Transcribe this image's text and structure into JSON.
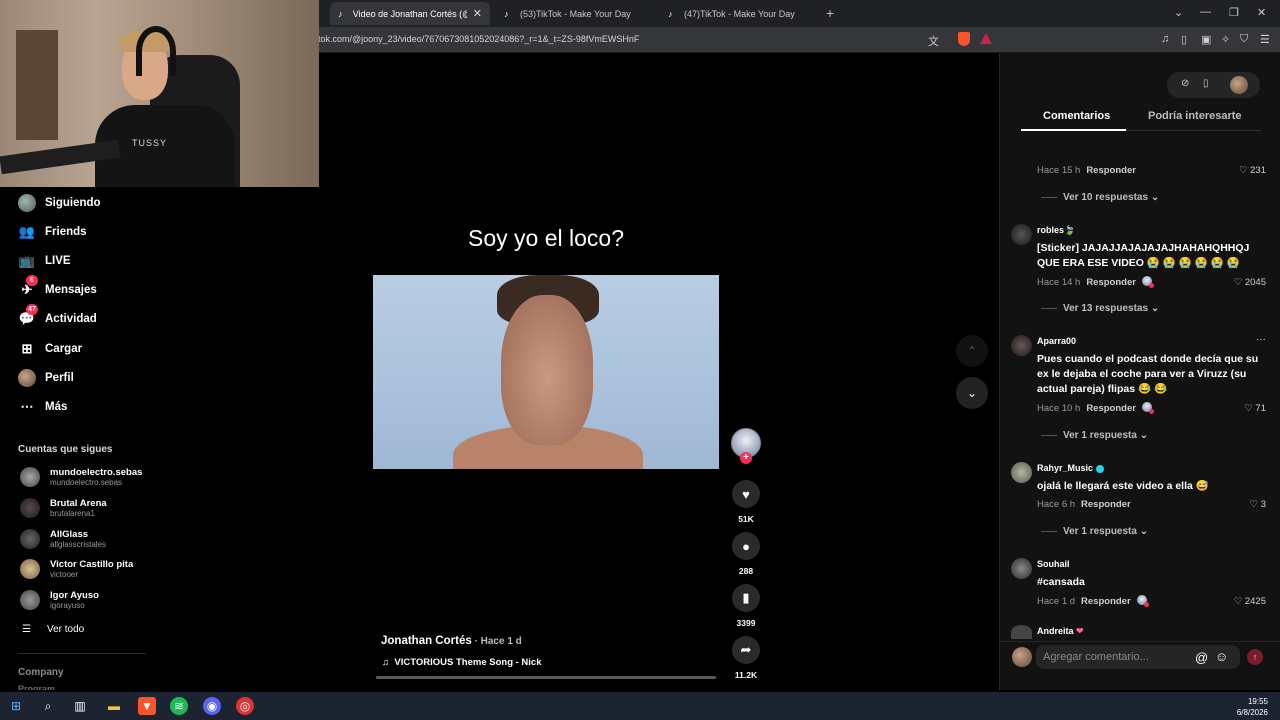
{
  "browser": {
    "tabs": [
      {
        "title": "Video de Jonathan Cortés (@joo",
        "active": true
      },
      {
        "title": "(53)TikTok - Make Your Day",
        "active": false
      },
      {
        "title": "(47)TikTok - Make Your Day",
        "active": false
      }
    ],
    "url": "tok.com/@joony_23/video/7670673081052024086?_r=1&_t=ZS-98fVmEWSHnF"
  },
  "webcam": {
    "shirt_text": "TUSSY"
  },
  "sidebar": {
    "nav": [
      {
        "label": "Siguiendo",
        "icon": "following-avatar-icon",
        "badge": ""
      },
      {
        "label": "Friends",
        "icon": "friends-icon",
        "badge": ""
      },
      {
        "label": "LIVE",
        "icon": "live-icon",
        "badge": ""
      },
      {
        "label": "Mensajes",
        "icon": "messages-icon",
        "badge": "6"
      },
      {
        "label": "Actividad",
        "icon": "activity-icon",
        "badge": "47"
      },
      {
        "label": "Cargar",
        "icon": "upload-icon",
        "badge": ""
      },
      {
        "label": "Perfil",
        "icon": "profile-avatar-icon",
        "badge": ""
      },
      {
        "label": "Más",
        "icon": "more-icon",
        "badge": ""
      }
    ],
    "following_title": "Cuentas que sigues",
    "following": [
      {
        "name": "mundoelectro.sebas",
        "handle": "mundoelectro.sebas"
      },
      {
        "name": "Brutal Arena",
        "handle": "brutalarena1"
      },
      {
        "name": "AllGlass",
        "handle": "allglasscristales"
      },
      {
        "name": "Victor Castillo pita",
        "handle": "victooer"
      },
      {
        "name": "Igor Ayuso",
        "handle": "igorayuso"
      }
    ],
    "see_all": "Ver todo",
    "company": "Company",
    "program": "Program"
  },
  "video": {
    "caption_title": "Soy yo el loco?",
    "author": "Jonathan Cortés",
    "time": " · Hace 1 d",
    "music": "VICTORIOUS Theme Song - Nick",
    "likes": "51K",
    "comments": "288",
    "saves": "3399",
    "shares": "11.2K"
  },
  "panel": {
    "tabs": {
      "comments": "Comentarios",
      "suggested": "Podría interesarte"
    },
    "reply_label": "Responder",
    "comments": [
      {
        "user": "",
        "text": "",
        "meta": "Hace 15 h",
        "likes": "231",
        "replies": "Ver 10 respuestas"
      },
      {
        "user": "robles",
        "text": "[Sticker] JAJAJJAJAJAJAJHAHAHQHHQJ QUE ERA ESE VIDEO 😭 😭 😭 😭 😭 😭",
        "meta": "Hace 14 h",
        "likes": "2045",
        "replies": "Ver 13 respuestas"
      },
      {
        "user": "Aparra00",
        "text": "Pues cuando el podcast donde decía que su ex le dejaba el coche para ver a Viruzz (su actual pareja) flipas 😂 😂",
        "meta": "Hace 10 h",
        "likes": "71",
        "replies": "Ver 1 respuesta"
      },
      {
        "user": "Rahyr_Music",
        "text": "ojalá le llegará este video a ella 😅",
        "meta": "Hace 6 h",
        "likes": "3",
        "replies": "Ver 1 respuesta"
      },
      {
        "user": "Souhail",
        "text": "#cansada",
        "meta": "Hace 1 d",
        "likes": "2425",
        "replies": ""
      },
      {
        "user": "Andreita",
        "text": "",
        "meta": "",
        "likes": "",
        "replies": ""
      }
    ],
    "comment_placeholder": "Agregar comentario..."
  },
  "taskbar": {
    "time": "19:55",
    "date": "6/8/2026"
  }
}
